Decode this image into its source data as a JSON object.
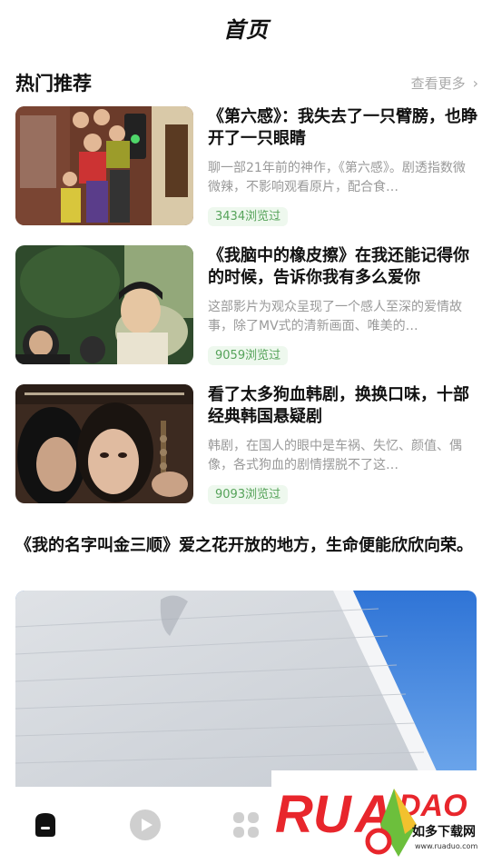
{
  "header": {
    "title": "首页"
  },
  "section": {
    "title": "热门推荐",
    "more_label": "查看更多"
  },
  "articles": [
    {
      "title": "《第六感》：我失去了一只臂膀，也睁开了一只眼睛",
      "desc": "聊一部21年前的神作，《第六感》。剧透指数微微辣，不影响观看原片，配合食…",
      "views": "3434浏览过"
    },
    {
      "title": "《我脑中的橡皮擦》在我还能记得你的时候，告诉你我有多么爱你",
      "desc": "这部影片为观众呈现了一个感人至深的爱情故事，除了MV式的清新画面、唯美的…",
      "views": "9059浏览过"
    },
    {
      "title": "看了太多狗血韩剧，换换口味，十部经典韩国悬疑剧",
      "desc": "韩剧，在国人的眼中是车祸、失忆、颜值、偶像，各式狗血的剧情摆脱不了这…",
      "views": "9093浏览过"
    }
  ],
  "featured": {
    "title": "《我的名字叫金三顺》爱之花开放的地方，生命便能欣欣向荣。"
  },
  "watermark": {
    "brand": "RUANDADO",
    "cn": "如多下载网",
    "url": "www.ruaduo.com"
  },
  "tabs": [
    {
      "icon": "home-icon",
      "active": true
    },
    {
      "icon": "play-icon",
      "active": false
    },
    {
      "icon": "grid-icon",
      "active": false
    }
  ],
  "colors": {
    "accent": "#56a35a",
    "views_bg": "#eef8ee",
    "muted": "#999999",
    "watermark_red": "#e8262c",
    "watermark_green": "#6cbf3c"
  }
}
